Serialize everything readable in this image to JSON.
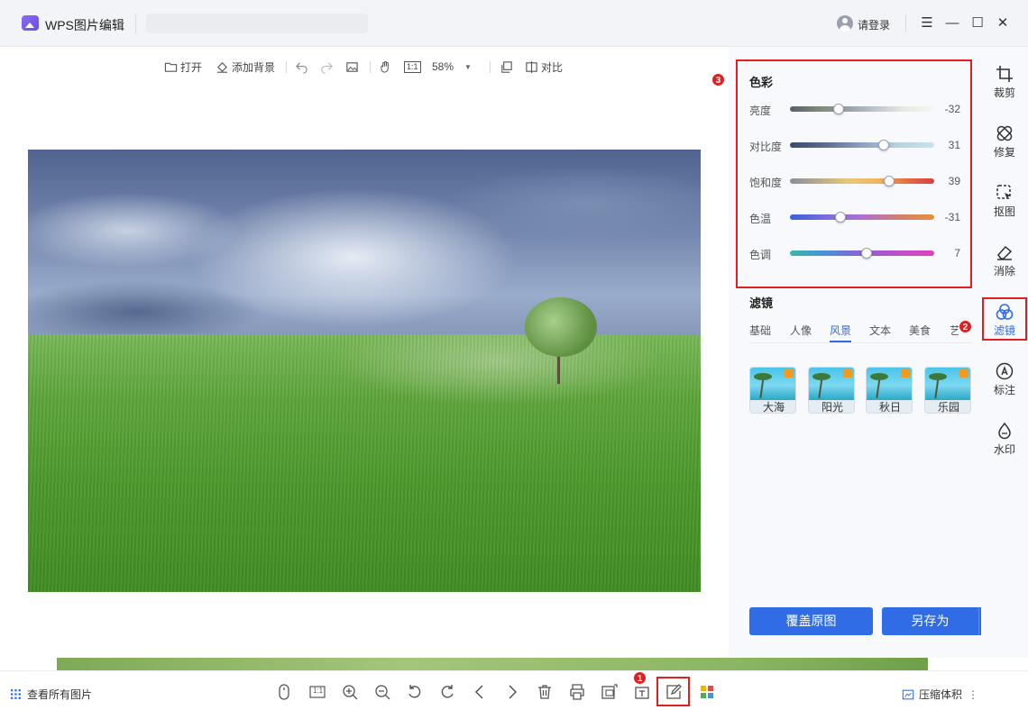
{
  "app": {
    "title": "WPS图片编辑",
    "login_label": "请登录"
  },
  "window_controls": {
    "menu": "☰",
    "minimize": "—",
    "maximize": "☐",
    "close": "✕"
  },
  "toolbar": {
    "open": "打开",
    "add_background": "添加背景",
    "actual_size": "1:1",
    "zoom": "58%",
    "compare": "对比"
  },
  "color_panel": {
    "title": "色彩",
    "sliders": [
      {
        "label": "亮度",
        "value": "-32",
        "fraction": 0.34
      },
      {
        "label": "对比度",
        "value": "31",
        "fraction": 0.65
      },
      {
        "label": "饱和度",
        "value": "39",
        "fraction": 0.69
      },
      {
        "label": "色温",
        "value": "-31",
        "fraction": 0.35
      },
      {
        "label": "色调",
        "value": "7",
        "fraction": 0.53
      }
    ]
  },
  "filter_panel": {
    "title": "滤镜",
    "tabs": [
      "基础",
      "人像",
      "风景",
      "文本",
      "美食",
      "艺"
    ],
    "active_tab": "风景",
    "thumbnails": [
      "大海",
      "阳光",
      "秋日",
      "乐园"
    ]
  },
  "actions": {
    "overwrite": "覆盖原图",
    "save_as": "另存为"
  },
  "tools": [
    {
      "label": "裁剪",
      "icon": "crop-icon"
    },
    {
      "label": "修复",
      "icon": "bandage-icon"
    },
    {
      "label": "抠图",
      "icon": "cutout-icon"
    },
    {
      "label": "消除",
      "icon": "eraser-icon"
    },
    {
      "label": "滤镜",
      "icon": "filter-icon"
    },
    {
      "label": "标注",
      "icon": "annotate-icon"
    },
    {
      "label": "水印",
      "icon": "watermark-icon"
    }
  ],
  "badges": {
    "one": "1",
    "two": "2",
    "three": "3"
  },
  "bottom": {
    "view_all": "查看所有图片",
    "actual_size": "1:1",
    "compress": "压缩体积"
  },
  "colors": {
    "accent": "#2f6ce5",
    "highlight_red": "#e02020"
  }
}
